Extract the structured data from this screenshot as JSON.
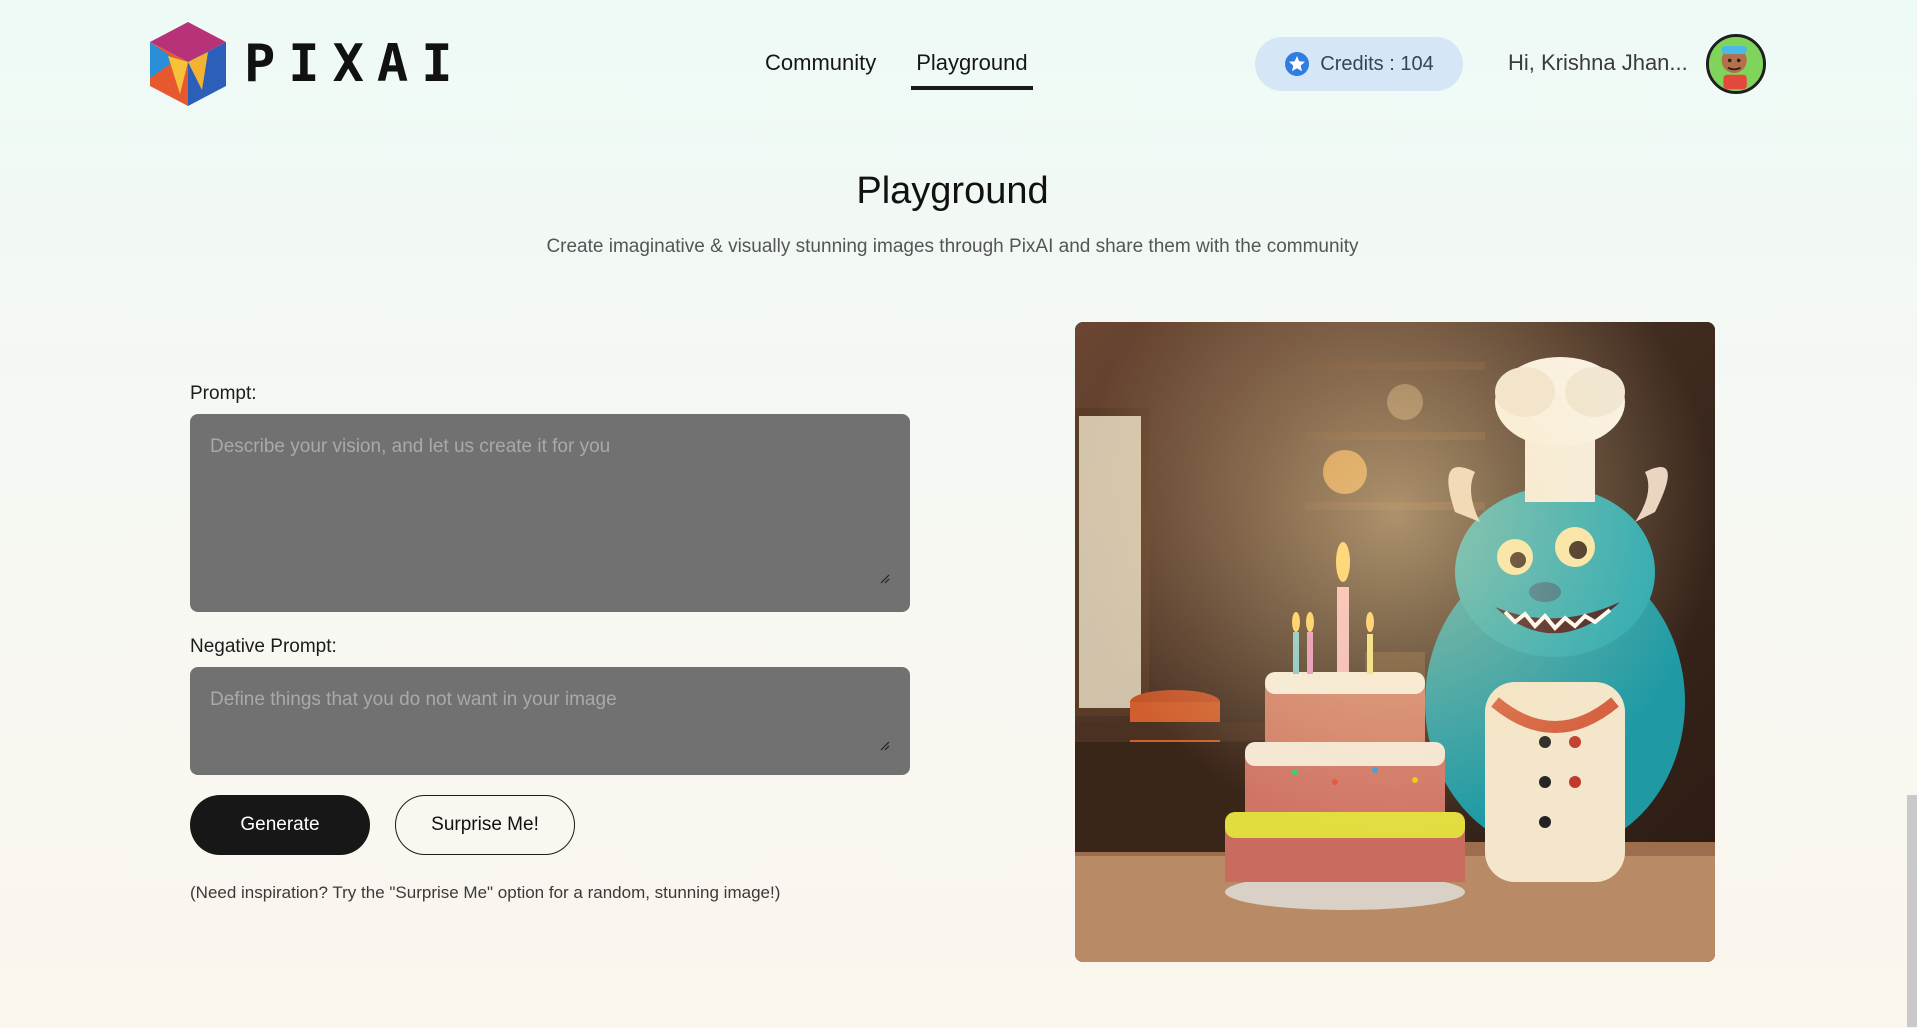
{
  "brand": {
    "name": "PIXAI"
  },
  "nav": {
    "items": [
      {
        "label": "Community",
        "active": false
      },
      {
        "label": "Playground",
        "active": true
      }
    ]
  },
  "user": {
    "credits_label": "Credits : 104",
    "greeting": "Hi, Krishna Jhan..."
  },
  "page": {
    "title": "Playground",
    "subtitle": "Create imaginative & visually stunning images through PixAI and share them with the community"
  },
  "form": {
    "prompt_label": "Prompt:",
    "prompt_placeholder": "Describe your vision, and let us create it for you",
    "prompt_value": "",
    "negative_label": "Negative Prompt:",
    "negative_placeholder": "Define things that you do not want in your image",
    "negative_value": "",
    "generate_label": "Generate",
    "surprise_label": "Surprise Me!",
    "hint": "(Need inspiration? Try the \"Surprise Me\" option for a random, stunning image!)"
  },
  "icons": {
    "credits": "star-icon",
    "avatar": "user-avatar"
  },
  "colors": {
    "accent_dark": "#171717",
    "credits_bg": "#d5e6f7",
    "star_blue": "#2f7de1",
    "input_bg": "#717171"
  }
}
